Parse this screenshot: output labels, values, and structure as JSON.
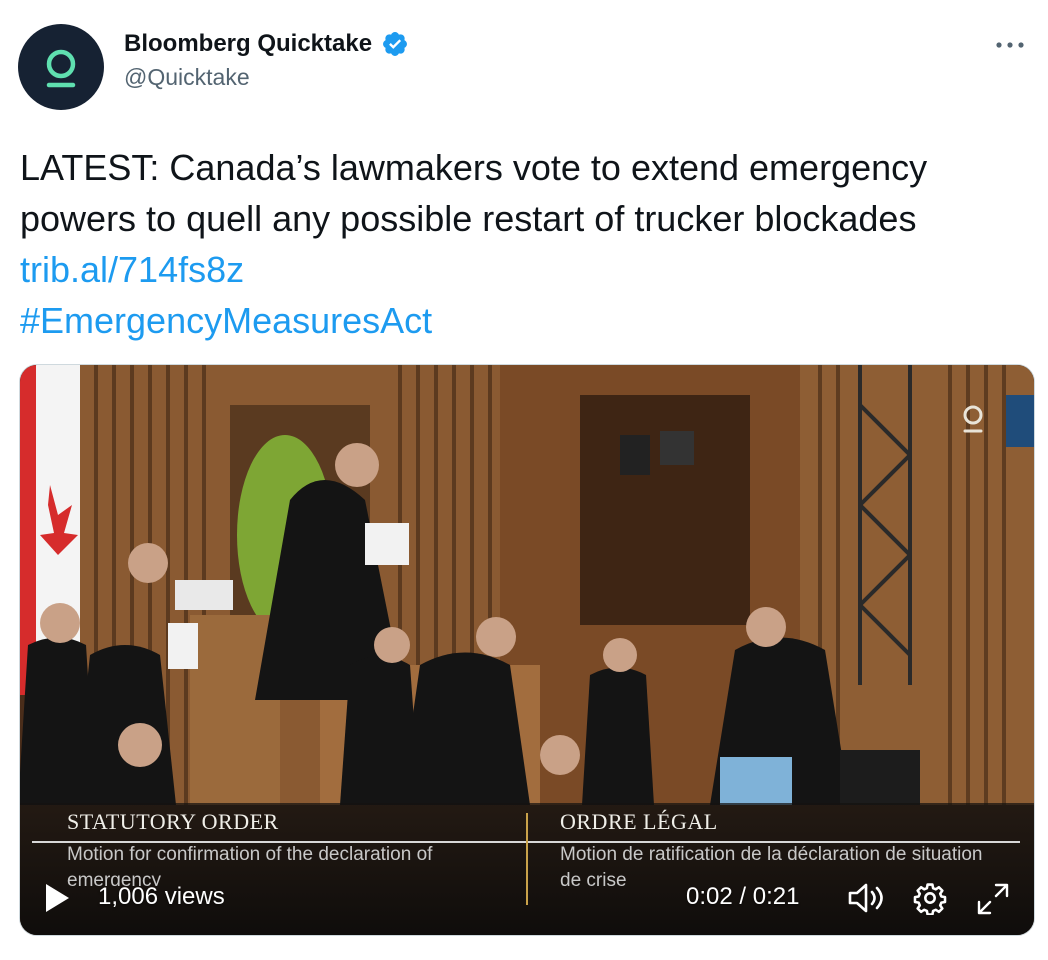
{
  "author": {
    "display_name": "Bloomberg Quicktake",
    "handle": "@Quicktake",
    "verified": true,
    "avatar_icon": "quicktake-logo-icon",
    "avatar_bg": "#162233",
    "avatar_accent": "#5fe0b0"
  },
  "menu": {
    "icon": "more-icon"
  },
  "tweet": {
    "text": "LATEST: Canada’s lawmakers vote to extend emergency powers to quell any possible restart of trucker blockades",
    "link": "trib.al/714fs8z",
    "hashtag": "#EmergencyMeasuresAct",
    "link_color": "#1d9bf0"
  },
  "video": {
    "lower_third": {
      "left_heading": "STATUTORY ORDER",
      "left_body": "Motion for confirmation of the declaration of emergency",
      "right_heading": "ORDRE LÉGAL",
      "right_body": "Motion de ratification de la déclaration de situation de crise"
    },
    "views": "1,006 views",
    "time": "0:02 / 0:21",
    "icons": {
      "play": "play-icon",
      "volume": "volume-icon",
      "settings": "gear-icon",
      "fullscreen": "fullscreen-icon",
      "watermark": "quicktake-logo-icon"
    }
  }
}
